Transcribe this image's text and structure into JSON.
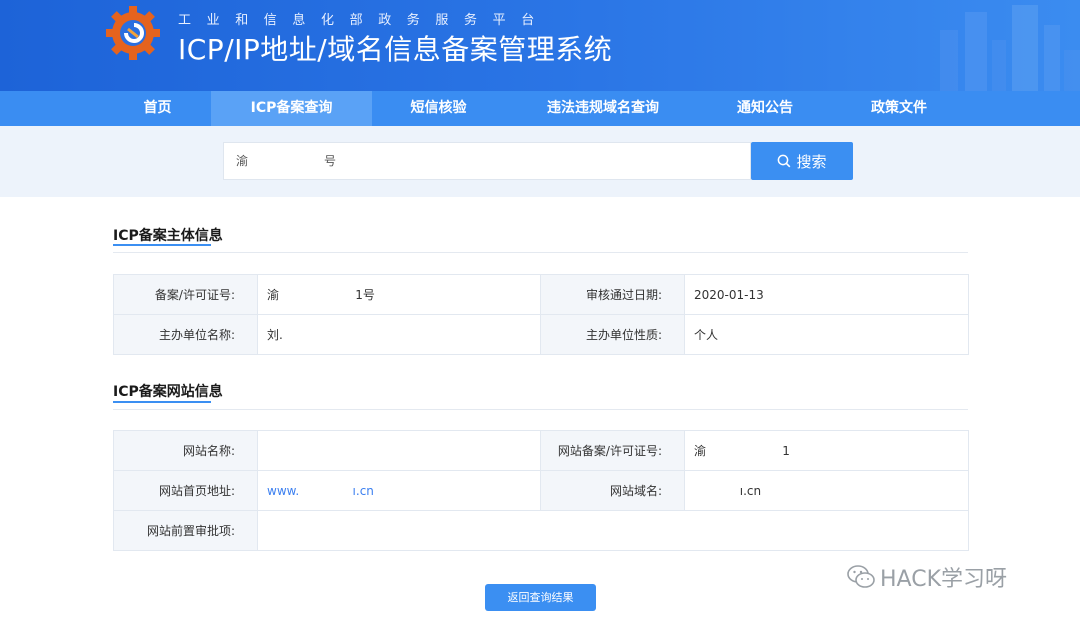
{
  "header": {
    "subtitle": "工业和信息化部政务服务平台",
    "title": "ICP/IP地址/域名信息备案管理系统"
  },
  "nav": {
    "items": [
      {
        "label": "首页"
      },
      {
        "label": "ICP备案查询",
        "active": true
      },
      {
        "label": "短信核验"
      },
      {
        "label": "违法违规域名查询"
      },
      {
        "label": "通知公告"
      },
      {
        "label": "政策文件"
      }
    ]
  },
  "search": {
    "value_prefix": "渝",
    "value_suffix": "号",
    "button_label": "搜索",
    "icon": "search-icon"
  },
  "subject_section": {
    "title": "ICP备案主体信息",
    "rows": [
      {
        "k1": "备案/许可证号:",
        "v1": "渝                    1号",
        "k2": "审核通过日期:",
        "v2": "2020-01-13"
      },
      {
        "k1": "主办单位名称:",
        "v1": "刘.",
        "k2": "主办单位性质:",
        "v2": "个人"
      }
    ]
  },
  "website_section": {
    "title": "ICP备案网站信息",
    "rows": [
      {
        "k1": "网站名称:",
        "v1": "",
        "k2": "网站备案/许可证号:",
        "v2": "渝                    1"
      },
      {
        "k1": "网站首页地址:",
        "v1": "www.              ı.cn",
        "k2": "网站域名:",
        "v2": "            ı.cn"
      },
      {
        "k1": "网站前置审批项:",
        "v1": ""
      }
    ]
  },
  "back_button_label": "返回查询结果",
  "watermark": "HACK学习呀",
  "colors": {
    "primary": "#3b8ff2",
    "nav": "#3a8df2",
    "banner": "#2b76e6",
    "logo": "#e5631e"
  }
}
